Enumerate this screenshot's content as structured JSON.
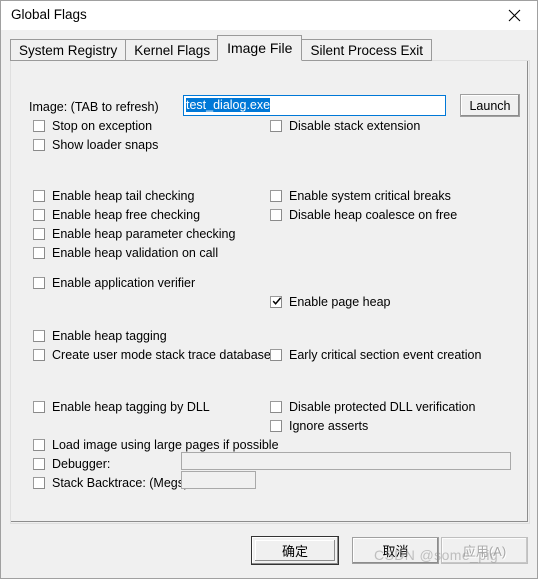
{
  "window": {
    "title": "Global Flags",
    "close_icon": "close-icon"
  },
  "tabs": [
    {
      "label": "System Registry",
      "active": false
    },
    {
      "label": "Kernel Flags",
      "active": false
    },
    {
      "label": "Image File",
      "active": true
    },
    {
      "label": "Silent Process Exit",
      "active": false
    }
  ],
  "image_file": {
    "image_label": "Image: (TAB to refresh)",
    "image_value": "test_dialog.exe",
    "image_placeholder": "",
    "launch_label": "Launch",
    "checks_top_left": [
      {
        "label": "Stop on exception",
        "checked": false
      },
      {
        "label": "Show loader snaps",
        "checked": false
      }
    ],
    "checks_top_right": [
      {
        "label": "Disable stack extension",
        "checked": false
      }
    ],
    "checks_heap_left": [
      {
        "label": "Enable heap tail checking",
        "checked": false
      },
      {
        "label": "Enable heap free checking",
        "checked": false
      },
      {
        "label": "Enable heap parameter checking",
        "checked": false
      },
      {
        "label": "Enable heap validation on call",
        "checked": false
      }
    ],
    "checks_heap_right": [
      {
        "label": "Enable system critical breaks",
        "checked": false
      },
      {
        "label": "Disable heap coalesce on free",
        "checked": false
      }
    ],
    "checks_verifier_left": [
      {
        "label": "Enable application verifier",
        "checked": false
      }
    ],
    "checks_verifier_right": [
      {
        "label": "Enable page heap",
        "checked": true
      }
    ],
    "checks_tagging_left": [
      {
        "label": "Enable heap tagging",
        "checked": false
      },
      {
        "label": "Create user mode stack trace database",
        "checked": false
      }
    ],
    "checks_tagging_right": [
      {
        "label": "Early critical section event creation",
        "checked": false
      }
    ],
    "checks_dll_left": [
      {
        "label": "Enable heap tagging by DLL",
        "checked": false
      }
    ],
    "checks_dll_right": [
      {
        "label": "Disable protected DLL verification",
        "checked": false
      },
      {
        "label": "Ignore asserts",
        "checked": false
      }
    ],
    "checks_bottom": [
      {
        "label": "Load image using large pages if possible",
        "checked": false
      },
      {
        "label": "Debugger:",
        "checked": false
      },
      {
        "label": "Stack Backtrace: (Megs)",
        "checked": false
      }
    ],
    "debugger_value": "",
    "stack_backtrace_value": ""
  },
  "footer": {
    "ok_label": "确定",
    "cancel_label": "取消",
    "apply_label": "应用(A)",
    "apply_accel": "A",
    "apply_disabled": true
  },
  "watermark": "CSDN @some_pig",
  "colors": {
    "accent_selection": "#0078d7",
    "window_bg": "#f0f0f0",
    "titlebar_bg": "#ffffff",
    "border": "#a0a0a0"
  }
}
